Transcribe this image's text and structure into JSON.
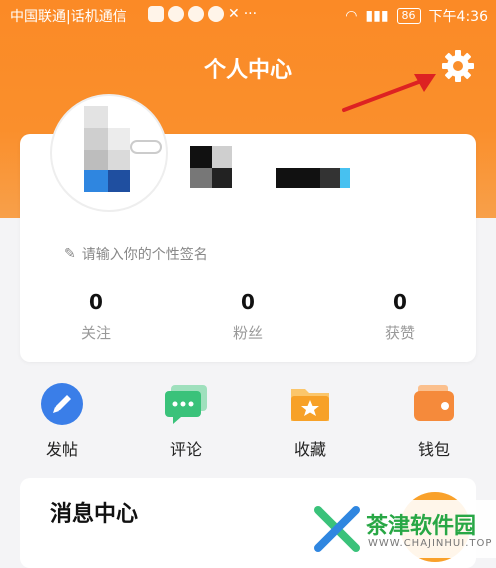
{
  "status_bar": {
    "carrier": "中国联通|话机通信",
    "battery": "86",
    "time": "下午4:36"
  },
  "header": {
    "title": "个人中心"
  },
  "profile": {
    "signature_placeholder": "请输入你的个性签名",
    "stats": [
      {
        "value": "0",
        "label": "关注"
      },
      {
        "value": "0",
        "label": "粉丝"
      },
      {
        "value": "0",
        "label": "获赞"
      }
    ]
  },
  "shortcuts": [
    {
      "label": "发帖",
      "icon": "pencil-icon"
    },
    {
      "label": "评论",
      "icon": "comment-icon"
    },
    {
      "label": "收藏",
      "icon": "star-folder-icon"
    },
    {
      "label": "钱包",
      "icon": "wallet-icon"
    }
  ],
  "messages": {
    "title": "消息中心"
  },
  "watermark": {
    "name": "茶津软件园",
    "url": "WWW.CHAJINHUI.TOP"
  },
  "colors": {
    "accent": "#fa8f2c",
    "blue": "#3a7ee8",
    "green": "#3ac27a",
    "wallet": "#f58a3b"
  }
}
